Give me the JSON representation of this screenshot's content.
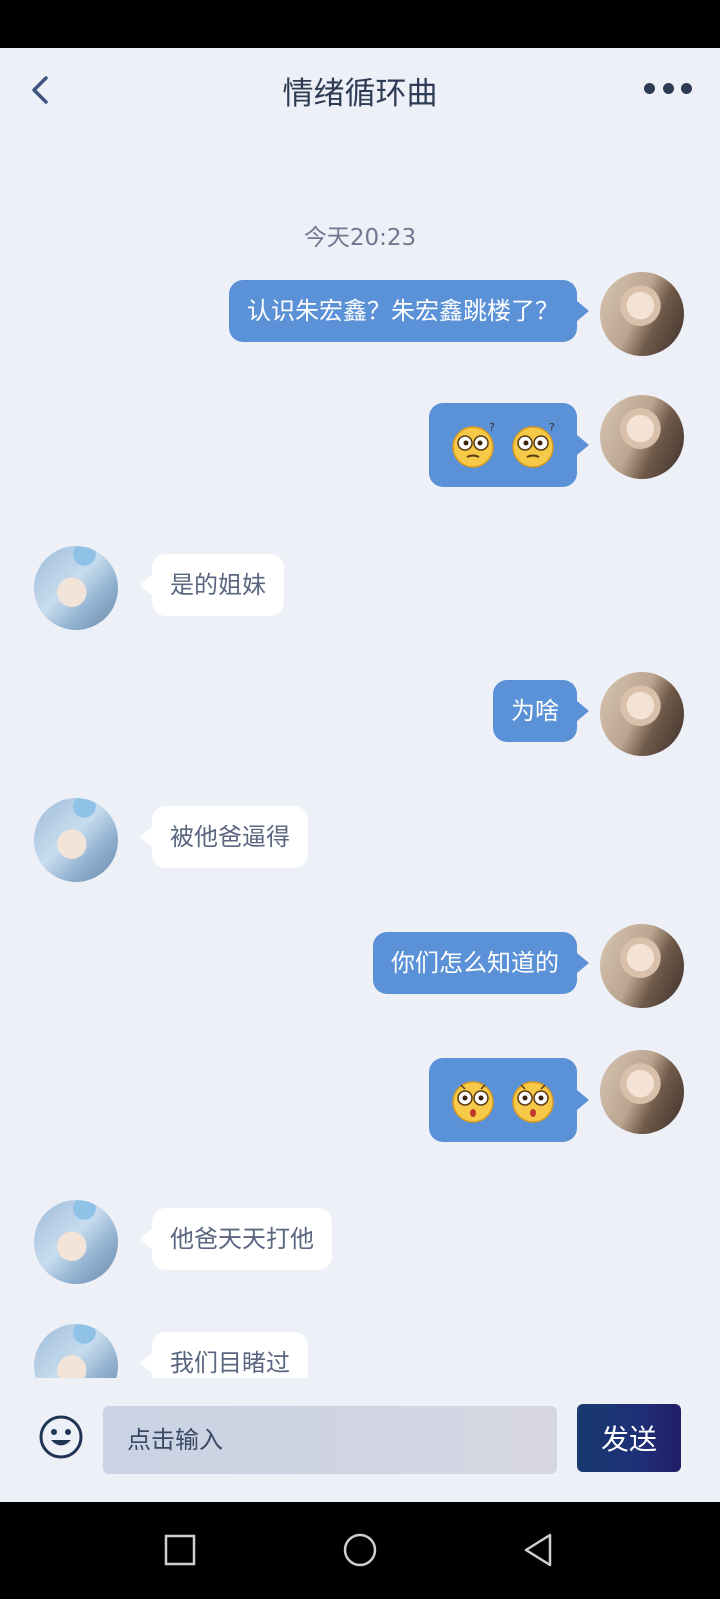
{
  "header": {
    "title": "情绪循环曲"
  },
  "chat": {
    "timestamp": "今天20:23",
    "messages": [
      {
        "side": "me",
        "type": "text",
        "text": "认识朱宏鑫？朱宏鑫跳楼了？"
      },
      {
        "side": "me",
        "type": "emoji",
        "emojis": [
          "confused-face",
          "confused-face"
        ]
      },
      {
        "side": "other",
        "type": "text",
        "text": "是的姐妹"
      },
      {
        "side": "me",
        "type": "text",
        "text": "为啥"
      },
      {
        "side": "other",
        "type": "text",
        "text": "被他爸逼得"
      },
      {
        "side": "me",
        "type": "text",
        "text": "你们怎么知道的"
      },
      {
        "side": "me",
        "type": "emoji",
        "emojis": [
          "shocked-face",
          "shocked-face"
        ]
      },
      {
        "side": "other",
        "type": "text",
        "text": "他爸天天打他"
      },
      {
        "side": "other",
        "type": "text",
        "text": "我们目睹过"
      }
    ]
  },
  "input": {
    "placeholder": "点击输入",
    "send_label": "发送"
  },
  "colors": {
    "my_bubble": "#5b91d6",
    "other_bubble": "#ffffff",
    "send_button": "#1f2f77",
    "title": "#2e3b55"
  }
}
